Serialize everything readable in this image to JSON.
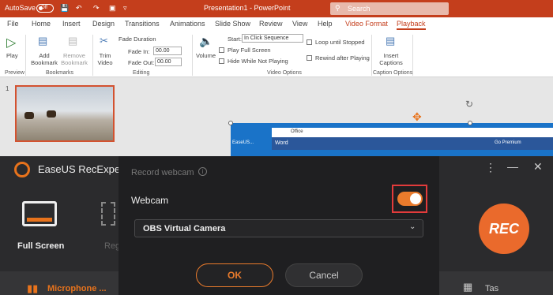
{
  "powerpoint": {
    "autosave_label": "AutoSave",
    "autosave_state": "Off",
    "title": "Presentation1 - PowerPoint",
    "search_placeholder": "Search",
    "tabs": [
      "File",
      "Home",
      "Insert",
      "Design",
      "Transitions",
      "Animations",
      "Slide Show",
      "Review",
      "View",
      "Help",
      "Video Format",
      "Playback"
    ],
    "active_tab": "Playback",
    "ribbon": {
      "play": "Play",
      "add_bookmark": "Add Bookmark",
      "remove_bookmark": "Remove Bookmark",
      "trim_video": "Trim Video",
      "fade_duration": "Fade Duration",
      "fade_in_label": "Fade In:",
      "fade_in_value": "00.00",
      "fade_out_label": "Fade Out:",
      "fade_out_value": "00.00",
      "volume": "Volume",
      "start_label": "Start:",
      "start_value": "In Click Sequence",
      "play_full_screen": "Play Full Screen",
      "hide_while_not_playing": "Hide While Not Playing",
      "loop_until_stopped": "Loop until Stopped",
      "rewind_after_playing": "Rewind after Playing",
      "insert_captions": "Insert Captions",
      "groups": [
        "Preview",
        "Bookmarks",
        "Editing",
        "Video Options",
        "Caption Options"
      ]
    },
    "slide_number": "1",
    "embedded_window": {
      "office_label": "Office",
      "word_label": "Word",
      "go_premium": "Go Premium",
      "desktop_label": "EaseUS..."
    }
  },
  "recexperts": {
    "app_title": "EaseUS RecExperts",
    "full_screen_label": "Full Screen",
    "region_label": "Reg",
    "microphone_label": "Microphone ...",
    "task_label": "Tas",
    "rec_label": "REC",
    "accent": "#ea7b2c"
  },
  "webcam_dialog": {
    "title": "Record webcam",
    "webcam_label": "Webcam",
    "webcam_enabled": true,
    "camera_value": "OBS Virtual Camera",
    "ok_label": "OK",
    "cancel_label": "Cancel"
  }
}
